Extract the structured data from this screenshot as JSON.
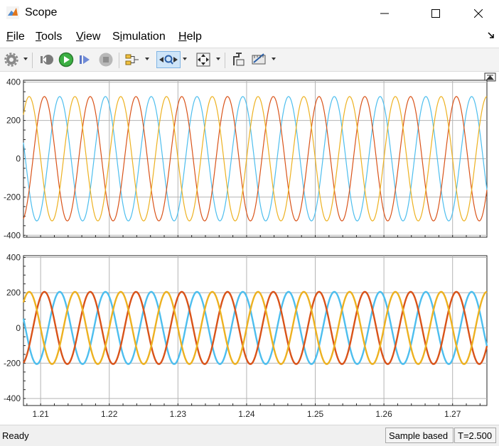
{
  "window": {
    "title": "Scope"
  },
  "menu": [
    {
      "label": "File",
      "accel_index": 0
    },
    {
      "label": "Tools",
      "accel_index": 0
    },
    {
      "label": "View",
      "accel_index": 0
    },
    {
      "label": "Simulation",
      "accel_index": 1
    },
    {
      "label": "Help",
      "accel_index": 0
    }
  ],
  "toolbar": {
    "icons": [
      "settings-icon",
      "step-back-icon",
      "run-icon",
      "step-forward-icon",
      "stop-icon",
      "signal-config-icon",
      "zoom-icon",
      "autoscale-icon",
      "highlight-block-icon",
      "measurements-icon"
    ]
  },
  "status": {
    "ready": "Ready",
    "mode": "Sample based",
    "time": "T=2.500"
  },
  "colors": {
    "blue": "#4dbeee",
    "orange": "#d95319",
    "yellow": "#edb120",
    "grid": "#b4b4b4"
  },
  "chart_data": [
    {
      "type": "line",
      "x_range": [
        1.2075,
        1.275
      ],
      "ylim": [
        -410,
        410
      ],
      "yticks": [
        -400,
        -200,
        0,
        200,
        400
      ],
      "xticks": [
        1.22,
        1.23,
        1.24,
        1.25,
        1.26,
        1.27
      ],
      "grid": true,
      "frequency_hz": 150,
      "series": [
        {
          "color": "blue",
          "amplitude": 325,
          "phase_deg": 120
        },
        {
          "color": "orange",
          "amplitude": 325,
          "phase_deg": 240
        },
        {
          "color": "yellow",
          "amplitude": 325,
          "phase_deg": 0
        }
      ]
    },
    {
      "type": "line",
      "x_range": [
        1.2075,
        1.275
      ],
      "ylim": [
        -440,
        410
      ],
      "yticks": [
        -400,
        -200,
        0,
        200,
        400
      ],
      "xticks": [
        1.21,
        1.22,
        1.23,
        1.24,
        1.25,
        1.26,
        1.27
      ],
      "xtick_labels": [
        "1.21",
        "1.22",
        "1.23",
        "1.24",
        "1.25",
        "1.26",
        "1.27"
      ],
      "grid": true,
      "frequency_hz": 150,
      "series": [
        {
          "color": "blue",
          "amplitude": 205,
          "phase_deg": 120
        },
        {
          "color": "orange",
          "amplitude": 205,
          "phase_deg": 240
        },
        {
          "color": "yellow",
          "amplitude": 205,
          "phase_deg": 0
        }
      ]
    }
  ]
}
